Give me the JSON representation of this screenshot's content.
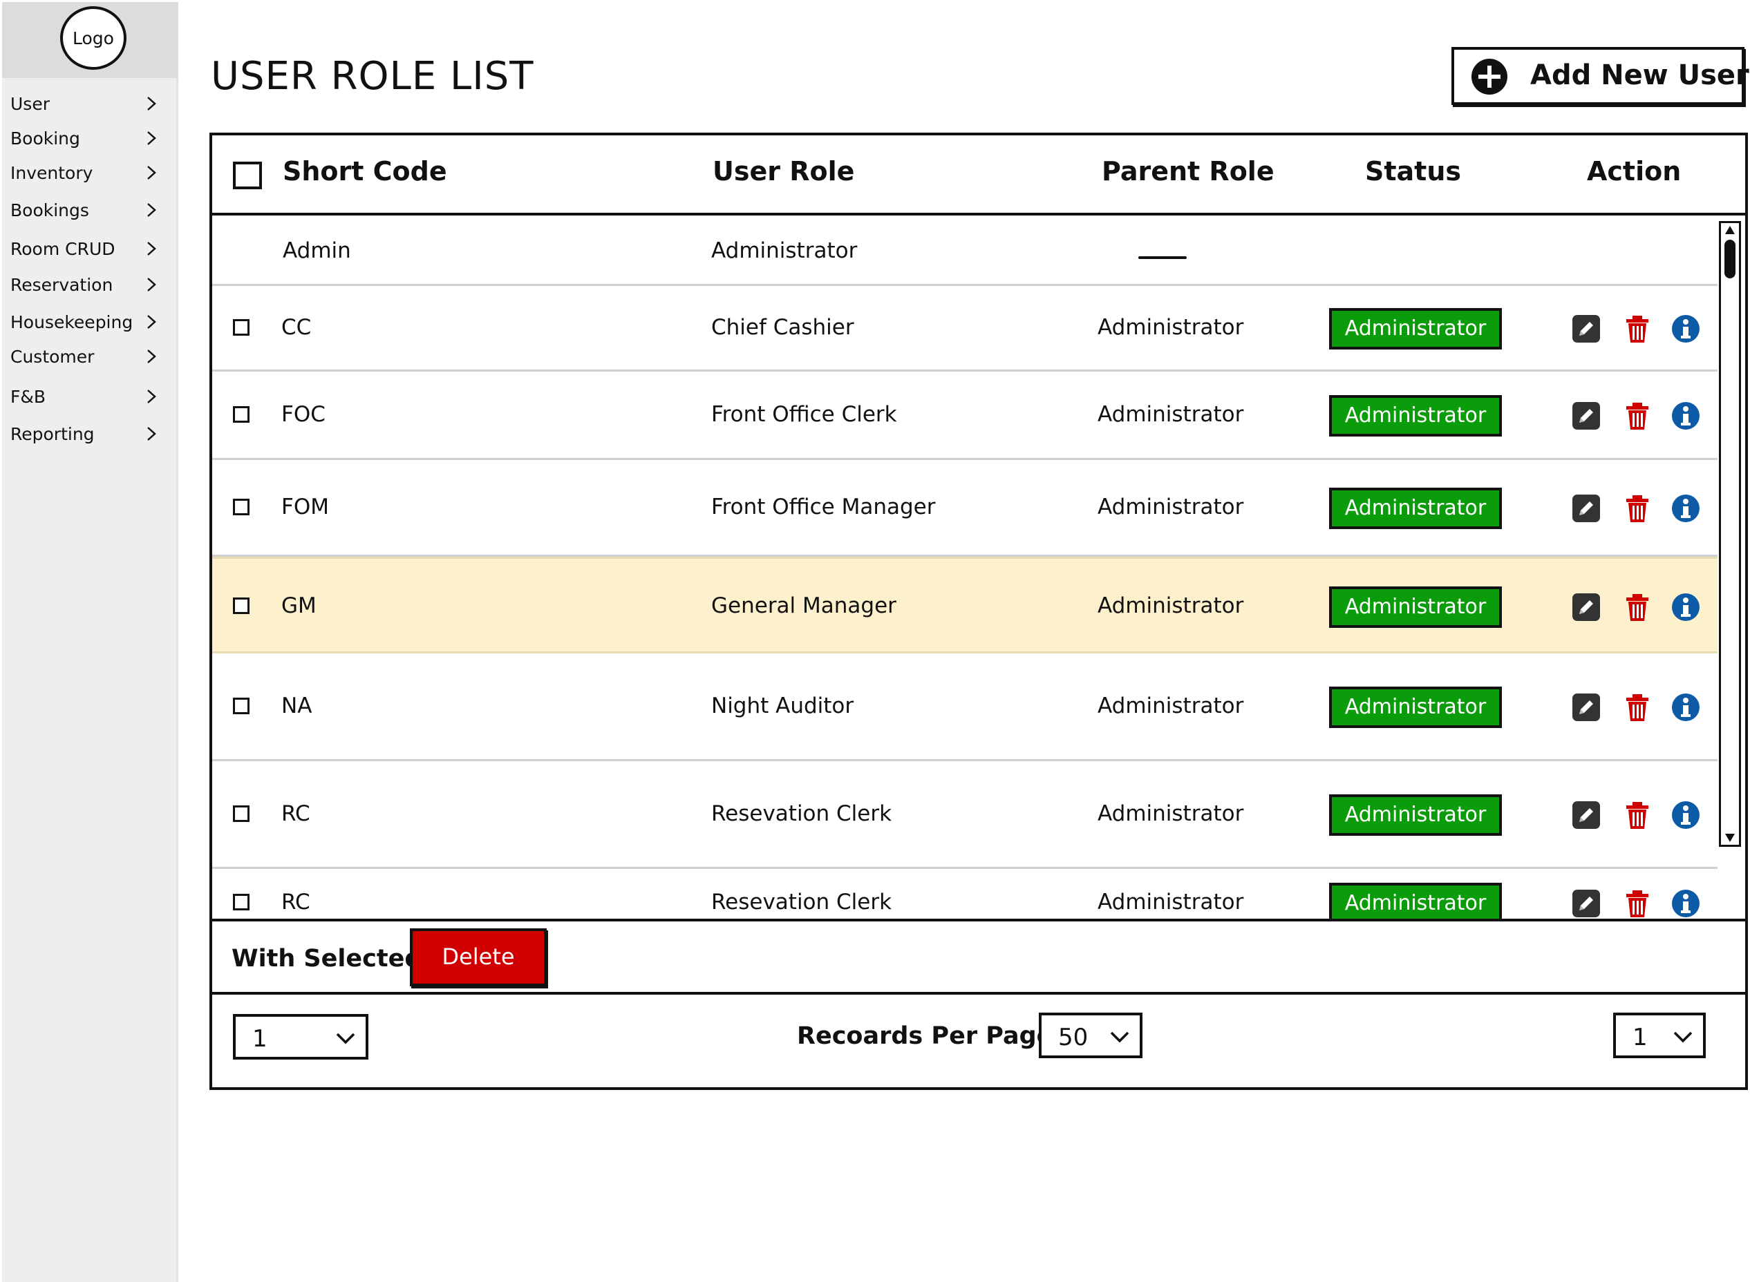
{
  "sidebar": {
    "logo": "Logo",
    "items": [
      {
        "label": "User"
      },
      {
        "label": "Booking"
      },
      {
        "label": "Inventory"
      },
      {
        "label": "Bookings"
      },
      {
        "label": "Room CRUD"
      },
      {
        "label": "Reservation"
      },
      {
        "label": "Housekeeping"
      },
      {
        "label": "Customer"
      },
      {
        "label": "F&B"
      },
      {
        "label": "Reporting"
      }
    ]
  },
  "header": {
    "title": "USER ROLE LIST",
    "add_button": "Add New User"
  },
  "table": {
    "columns": {
      "short_code": "Short Code",
      "user_role": "User Role",
      "parent_role": "Parent Role",
      "status": "Status",
      "action": "Action"
    },
    "rows": [
      {
        "code": "Admin",
        "role": "Administrator",
        "parent": "",
        "status": ""
      },
      {
        "code": "CC",
        "role": "Chief Cashier",
        "parent": "Administrator",
        "status": "Administrator"
      },
      {
        "code": "FOC",
        "role": "Front Office Clerk",
        "parent": "Administrator",
        "status": "Administrator"
      },
      {
        "code": "FOM",
        "role": "Front Office Manager",
        "parent": "Administrator",
        "status": "Administrator"
      },
      {
        "code": "GM",
        "role": "General Manager",
        "parent": "Administrator",
        "status": "Administrator",
        "highlighted": true
      },
      {
        "code": "NA",
        "role": "Night Auditor",
        "parent": "Administrator",
        "status": "Administrator"
      },
      {
        "code": "RC",
        "role": "Resevation Clerk",
        "parent": "Administrator",
        "status": "Administrator"
      },
      {
        "code": "RC",
        "role": "Resevation Clerk",
        "parent": "Administrator",
        "status": "Administrator"
      }
    ]
  },
  "bulk": {
    "label": "With Selected",
    "delete_button": "Delete"
  },
  "pager": {
    "page_left": "1",
    "records_label": "Recoards Per Page",
    "records_per_page": "50",
    "page_right": "1"
  },
  "colors": {
    "status_green": "#0b9c0b",
    "delete_red": "#d10000",
    "trash_red": "#d10000",
    "info_blue": "#0d5aa7",
    "highlight": "#fdf0cc"
  },
  "icons": {
    "add": "plus-circle-icon",
    "edit": "pencil-icon",
    "delete": "trash-icon",
    "info": "info-icon",
    "nav": "chevron-right-icon",
    "dropdown": "chevron-down-icon"
  }
}
